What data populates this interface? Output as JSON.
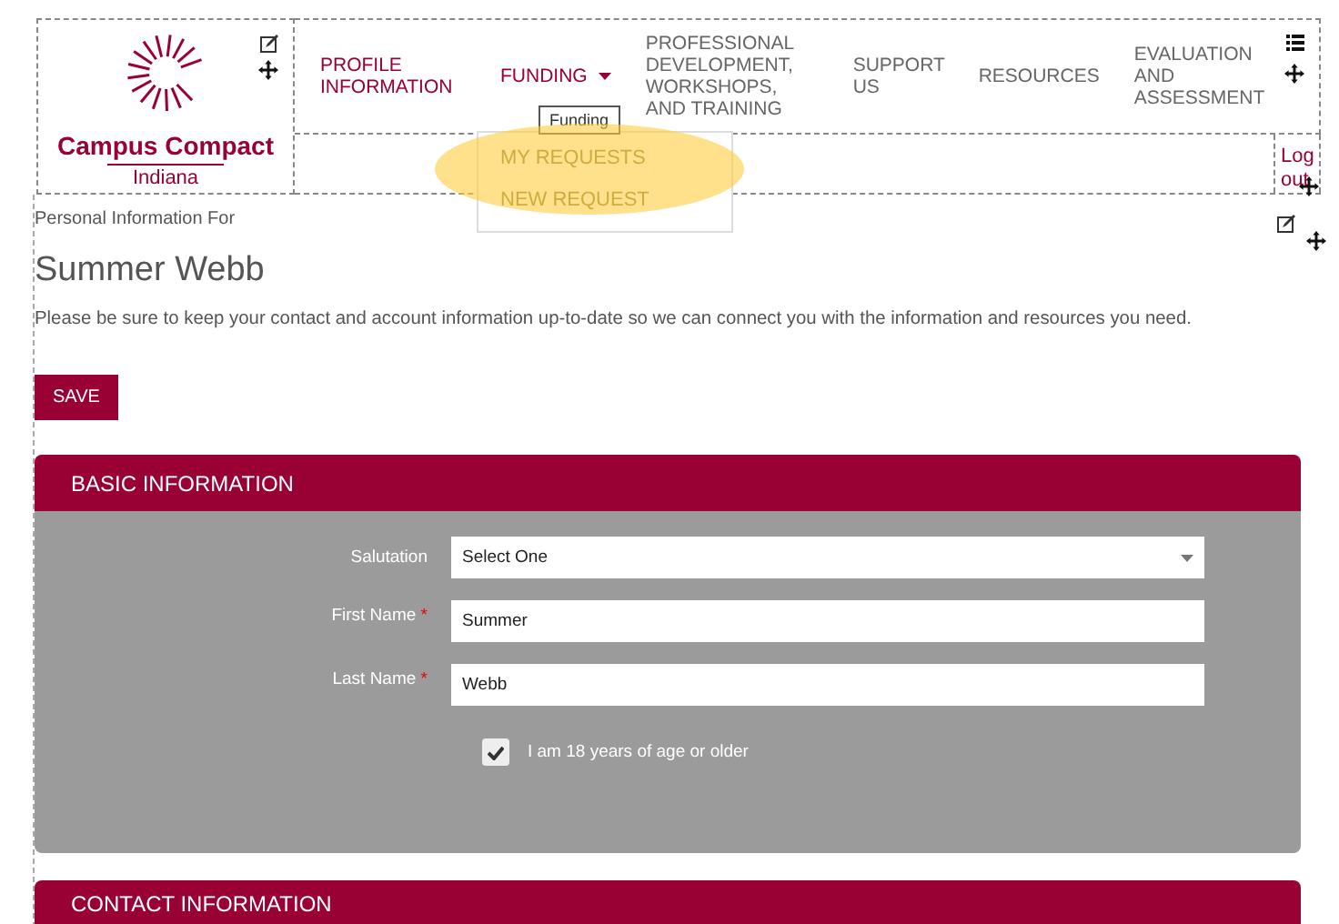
{
  "header": {
    "logo": {
      "name": "Campus Compact",
      "subtitle": "Indiana"
    },
    "nav": [
      {
        "kind": "link",
        "label": "PROFILE INFORMATION",
        "selected": true
      },
      {
        "kind": "menu",
        "label": "FUNDING",
        "selected": true
      },
      {
        "kind": "link",
        "label": "PROFESSIONAL DEVELOPMENT, WORKSHOPS, AND TRAINING",
        "selected": false
      },
      {
        "kind": "link",
        "label": "SUPPORT US",
        "selected": false
      },
      {
        "kind": "link",
        "label": "RESOURCES",
        "selected": false
      },
      {
        "kind": "link",
        "label": "EVALUATION AND ASSESSMENT",
        "selected": false
      }
    ],
    "tooltip": "Funding",
    "dropdown": [
      {
        "label": "MY REQUESTS"
      },
      {
        "label": "NEW REQUEST"
      }
    ],
    "logout": "Log out"
  },
  "page": {
    "caption": "Personal Information For",
    "name": "Summer Webb",
    "intro": "Please be sure to keep your contact and account information up-to-date so we can connect you with the information and resources you need.",
    "save": "SAVE"
  },
  "sections": [
    {
      "title": "BASIC INFORMATION",
      "fields": [
        {
          "kind": "select",
          "label": "Salutation",
          "value": "Select One"
        },
        {
          "kind": "text",
          "label": "First Name",
          "marker": "*",
          "value": "Summer"
        },
        {
          "kind": "text",
          "label": "Last Name",
          "marker": "*",
          "value": "Webb"
        }
      ],
      "checkbox": {
        "label": "I am 18 years of age or older",
        "checked": true
      }
    },
    {
      "title": "CONTACT INFORMATION"
    }
  ]
}
